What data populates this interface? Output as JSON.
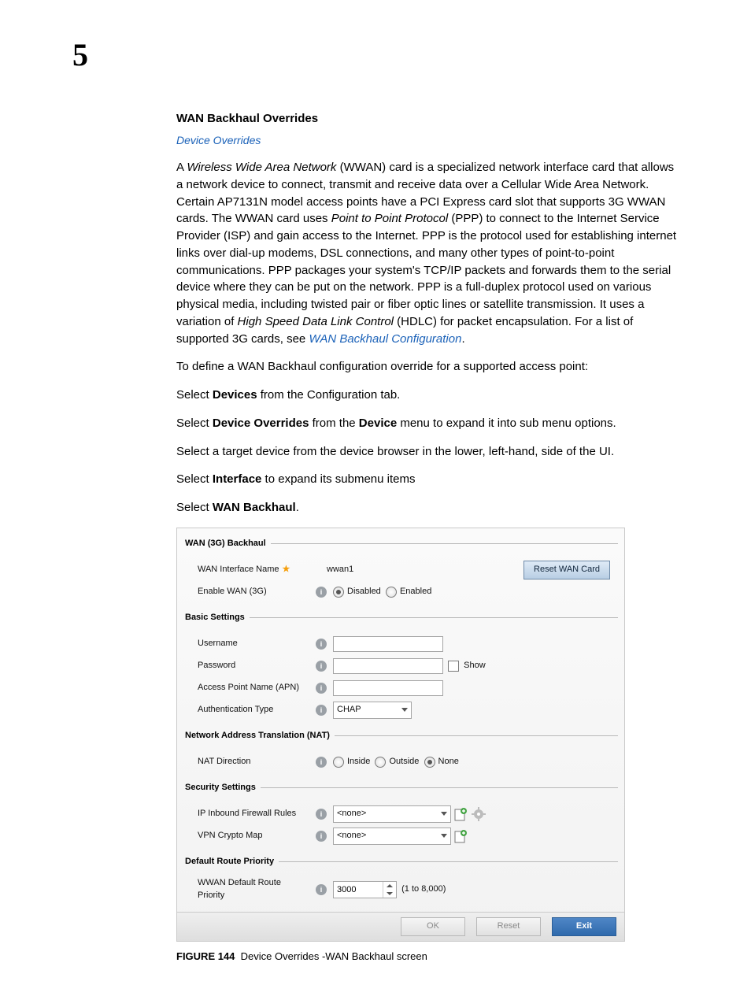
{
  "chapter": "5",
  "h1": "WAN Backhaul Overrides",
  "breadcrumb": "Device Overrides",
  "p1a": "A ",
  "p1b": "Wireless Wide Area Network",
  "p1c": " (WWAN) card is a specialized network interface card that allows a network device to connect, transmit and receive data over a Cellular Wide Area Network. Certain AP7131N model access points have a PCI Express card slot that supports 3G WWAN cards. The WWAN card uses ",
  "p1d": "Point to Point Protocol",
  "p1e": " (PPP) to connect to the Internet Service Provider (ISP) and gain access to the Internet. PPP is the protocol used for establishing internet links over dial-up modems, DSL connections, and many other types of point-to-point communications. PPP packages your system's TCP/IP packets and forwards them to the serial device where they can be put on the network. PPP is a full-duplex protocol used on various physical media, including twisted pair or fiber optic lines or satellite transmission. It uses a variation of ",
  "p1f": "High Speed Data Link Control",
  "p1g": " (HDLC) for packet encapsulation. For a list of supported 3G cards, see ",
  "p1link": "WAN Backhaul Configuration",
  "p1h": ".",
  "p2": "To define a WAN Backhaul configuration override for a supported access point:",
  "s1a": "Select ",
  "s1b": "Devices",
  "s1c": " from the Configuration tab.",
  "s2a": "Select ",
  "s2b": "Device Overrides",
  "s2c": " from the ",
  "s2d": "Device",
  "s2e": " menu to expand it into sub menu options.",
  "s3": "Select a target device from the device browser in the lower, left-hand, side of the UI.",
  "s4a": "Select ",
  "s4b": "Interface",
  "s4c": " to expand its submenu items",
  "s5a": "Select ",
  "s5b": "WAN Backhaul",
  "s5c": ".",
  "panel": {
    "g1": "WAN (3G) Backhaul",
    "ifaceLabel": "WAN Interface Name",
    "ifaceValue": "wwan1",
    "enableLabel": "Enable WAN (3G)",
    "r_disabled": "Disabled",
    "r_enabled": "Enabled",
    "resetBtn": "Reset WAN Card",
    "g2": "Basic Settings",
    "username": "Username",
    "password": "Password",
    "show": "Show",
    "apn": "Access Point Name (APN)",
    "auth": "Authentication Type",
    "auth_v": "CHAP",
    "g3": "Network Address Translation (NAT)",
    "nat": "NAT Direction",
    "r_inside": "Inside",
    "r_outside": "Outside",
    "r_none": "None",
    "g4": "Security Settings",
    "fw": "IP Inbound Firewall Rules",
    "none": "<none>",
    "vpn": "VPN Crypto Map",
    "g5": "Default Route Priority",
    "drp": "WWAN Default Route Priority",
    "drp_v": "3000",
    "drp_hint": "(1 to 8,000)",
    "ok": "OK",
    "reset": "Reset",
    "exit": "Exit"
  },
  "caption_a": "FIGURE 144",
  "caption_b": "Device Overrides -WAN Backhaul screen"
}
